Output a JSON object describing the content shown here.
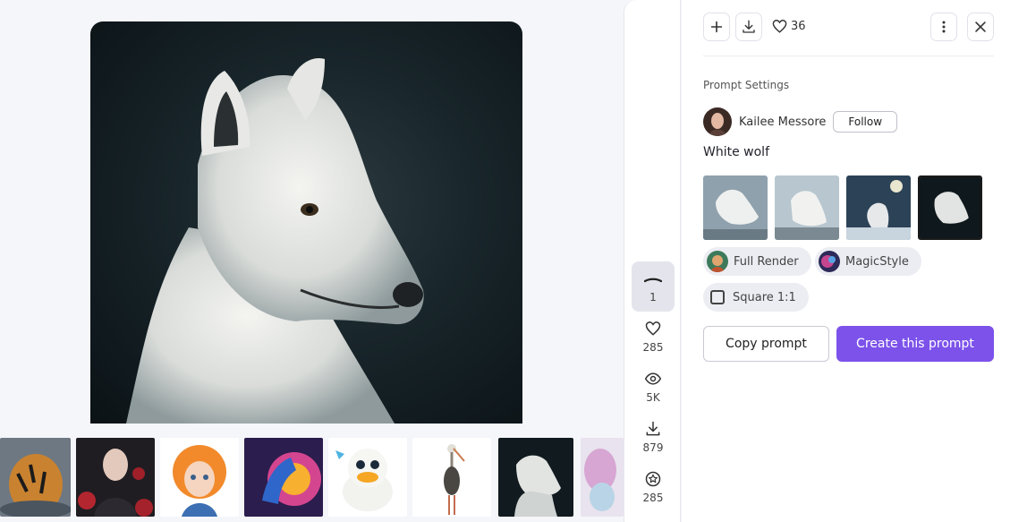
{
  "viewer": {
    "main_image_icon": "white-wolf-image"
  },
  "thumbnails": [
    {
      "name": "tiger"
    },
    {
      "name": "gothic-woman-roses"
    },
    {
      "name": "orange-hair-girl"
    },
    {
      "name": "neon-horse"
    },
    {
      "name": "cartoon-duck"
    },
    {
      "name": "stork"
    },
    {
      "name": "white-wolf",
      "active": true
    },
    {
      "name": "butterfly"
    }
  ],
  "stats": {
    "current_count": "1",
    "likes": "285",
    "views": "5K",
    "downloads": "879",
    "stars": "285"
  },
  "panel": {
    "like_count": "36",
    "section_title": "Prompt Settings",
    "author_name": "Kailee Messore",
    "follow_label": "Follow",
    "prompt_text": "White wolf",
    "chips": {
      "render": "Full Render",
      "style": "MagicStyle",
      "aspect": "Square 1:1"
    },
    "copy_label": "Copy prompt",
    "create_label": "Create this prompt"
  },
  "colors": {
    "accent": "#7c52ea",
    "background": "#f5f6fa"
  }
}
